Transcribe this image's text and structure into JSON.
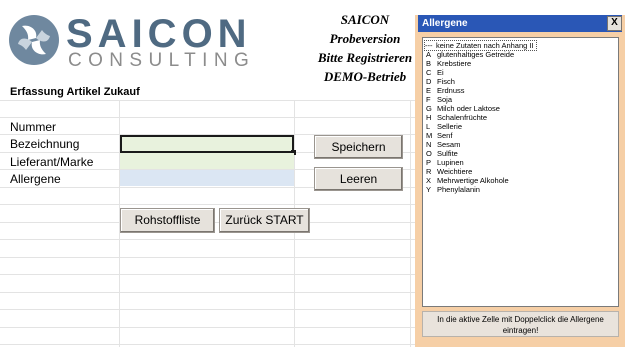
{
  "logo": {
    "name": "SAICON",
    "sub": "CONSULTING"
  },
  "promo": {
    "line1": "SAICON",
    "line2": "Probeversion",
    "line3": "Bitte Registrieren",
    "line4": "DEMO-Betrieb"
  },
  "form": {
    "title": "Erfassung Artikel Zukauf",
    "labels": {
      "nummer": "Nummer",
      "bezeichnung": "Bezeichnung",
      "lieferant": "Lieferant/Marke",
      "allergene": "Allergene"
    },
    "values": {
      "bezeichnung": "",
      "lieferant": "",
      "allergene": ""
    }
  },
  "buttons": {
    "speichern": "Speichern",
    "leeren": "Leeren",
    "rohstoffliste": "Rohstoffliste",
    "zurueck": "Zurück START"
  },
  "allergen_panel": {
    "title": "Allergene",
    "close": "X",
    "items": [
      {
        "code": "---",
        "label": "keine Zutaten nach Anhang II"
      },
      {
        "code": "A",
        "label": "glutenhaltiges Getreide"
      },
      {
        "code": "B",
        "label": "Krebstiere"
      },
      {
        "code": "C",
        "label": "Ei"
      },
      {
        "code": "D",
        "label": "Fisch"
      },
      {
        "code": "E",
        "label": "Erdnuss"
      },
      {
        "code": "F",
        "label": "Soja"
      },
      {
        "code": "G",
        "label": "Milch oder Laktose"
      },
      {
        "code": "H",
        "label": "Schalenfrüchte"
      },
      {
        "code": "L",
        "label": "Sellerie"
      },
      {
        "code": "M",
        "label": "Senf"
      },
      {
        "code": "N",
        "label": "Sesam"
      },
      {
        "code": "O",
        "label": "Sulfite"
      },
      {
        "code": "P",
        "label": "Lupinen"
      },
      {
        "code": "R",
        "label": "Weichtiere"
      },
      {
        "code": "X",
        "label": "Mehrwertige Alkohole"
      },
      {
        "code": "Y",
        "label": "Phenylalanin"
      }
    ],
    "footer": "In die aktive Zelle mit Doppelclick die Allergene eintragen!"
  },
  "colors": {
    "titlebar": "#2a57b6",
    "panel": "#f6cfa6",
    "logo_blue": "#4f6a82",
    "input_green": "#e8f2dd",
    "input_blue": "#dbe6f3"
  }
}
